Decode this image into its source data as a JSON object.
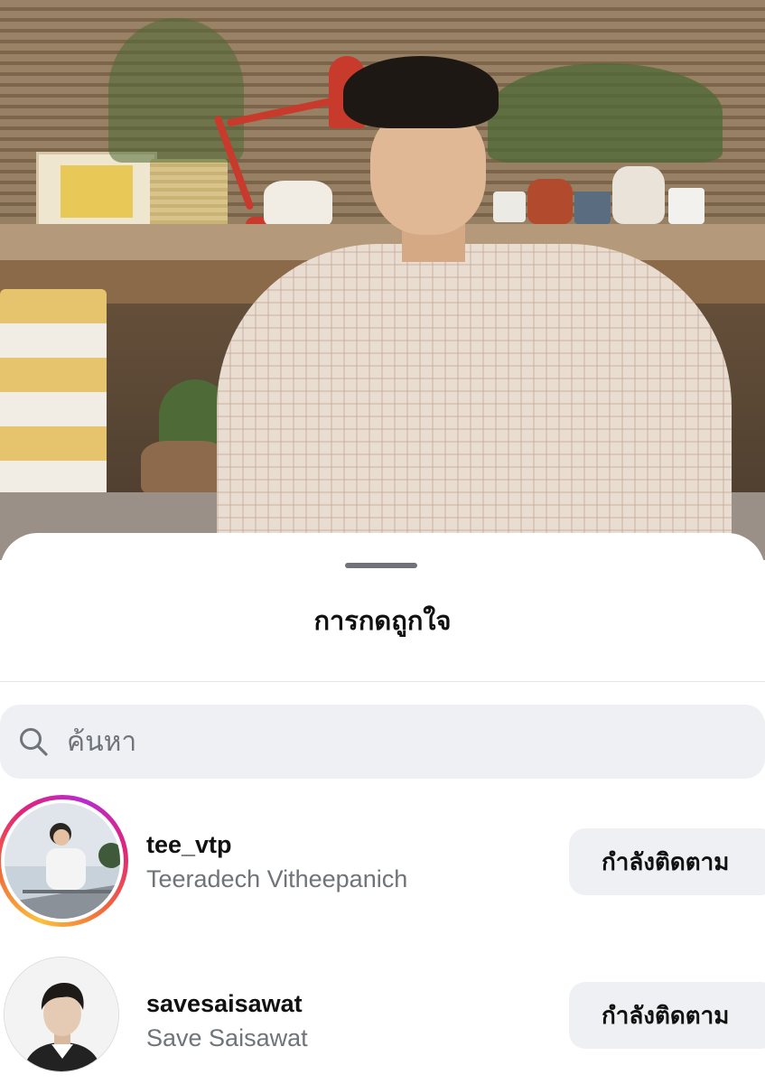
{
  "sheet": {
    "title": "การกดถูกใจ"
  },
  "search": {
    "placeholder": "ค้นหา",
    "icon": "search-icon"
  },
  "likers": [
    {
      "username": "tee_vtp",
      "full_name": "Teeradech Vitheepanich",
      "has_story_ring": true,
      "button_label": "กำลังติดตาม"
    },
    {
      "username": "savesaisawat",
      "full_name": "Save Saisawat",
      "has_story_ring": false,
      "button_label": "กำลังติดตาม"
    }
  ],
  "colors": {
    "sheet_background": "#ffffff",
    "secondary_text": "#6f737a",
    "button_background": "#eff0f3",
    "story_ring": [
      "#f9c23c",
      "#f26a3a",
      "#e0257a",
      "#b82ad1"
    ]
  }
}
